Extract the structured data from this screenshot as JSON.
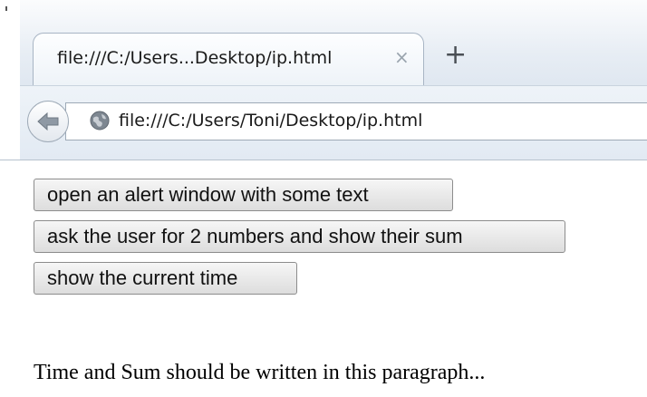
{
  "browser": {
    "tab": {
      "title": "file:///C:/Users...Desktop/ip.html",
      "close_glyph": "×"
    },
    "new_tab_glyph": "+",
    "url": "file:///C:/Users/Toni/Desktop/ip.html",
    "icons": {
      "back": "back-arrow-icon",
      "page": "globe-icon"
    }
  },
  "page": {
    "buttons": [
      {
        "label": "open an alert window with some text"
      },
      {
        "label": "ask the user for 2 numbers and show their sum"
      },
      {
        "label": "show the current time"
      }
    ],
    "paragraph": "Time and Sum should be written in this paragraph..."
  }
}
